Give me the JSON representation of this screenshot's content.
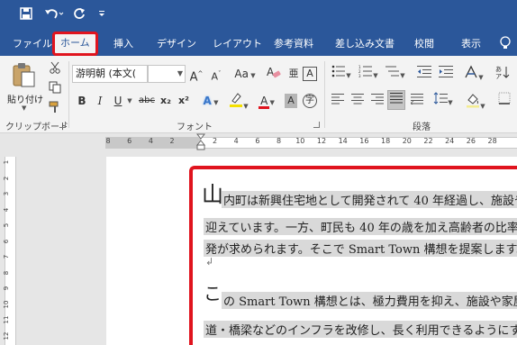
{
  "qat": {
    "save_icon": "save-icon",
    "undo_icon": "undo-icon",
    "redo_icon": "redo-icon",
    "customize_icon": "customize-icon"
  },
  "tabs": [
    {
      "label": "ファイル"
    },
    {
      "label": "ホーム"
    },
    {
      "label": "挿入"
    },
    {
      "label": "デザイン"
    },
    {
      "label": "レイアウト"
    },
    {
      "label": "参考資料"
    },
    {
      "label": "差し込み文書"
    },
    {
      "label": "校閲"
    },
    {
      "label": "表示"
    }
  ],
  "ribbon": {
    "clipboard": {
      "paste_label": "貼り付け",
      "group_label": "クリップボード"
    },
    "font": {
      "font_name": "游明朝 (本文(",
      "font_size": "",
      "bold": "B",
      "italic": "I",
      "underline": "U",
      "strike": "abc",
      "subscript": "x₂",
      "superscript": "x²",
      "case": "Aa",
      "group_label": "フォント"
    },
    "paragraph": {
      "group_label": "段落"
    }
  },
  "ruler_h_ticks": [
    "8",
    "6",
    "4",
    "2",
    "",
    "2",
    "4",
    "6",
    "8",
    "10",
    "12",
    "14",
    "16",
    "18",
    "20",
    "22",
    "24",
    "26",
    "28"
  ],
  "ruler_v_ticks": [
    "1",
    "2",
    "3",
    "4",
    "5",
    "6",
    "7",
    "8",
    "9",
    "10",
    "11",
    "12"
  ],
  "document": {
    "line1_dropcap": "山",
    "line1": "内町は新興住宅地として開発されて 40 年経過し、施設や",
    "line2": "迎えています。一方、町民も 40 年の歳を加え高齢者の比率が",
    "line3": "発が求められます。そこで Smart Town 構想を提案します。",
    "para_mark": "↲",
    "line4_dropcap": "こ",
    "line4": "の Smart Town 構想とは、極力費用を抑え、施設や家屋な",
    "line5": "道・橋梁などのインフラを改修し、長く利用できるようにする"
  },
  "colors": {
    "accent": "#2b579a",
    "highlight_border": "#e0141e"
  }
}
